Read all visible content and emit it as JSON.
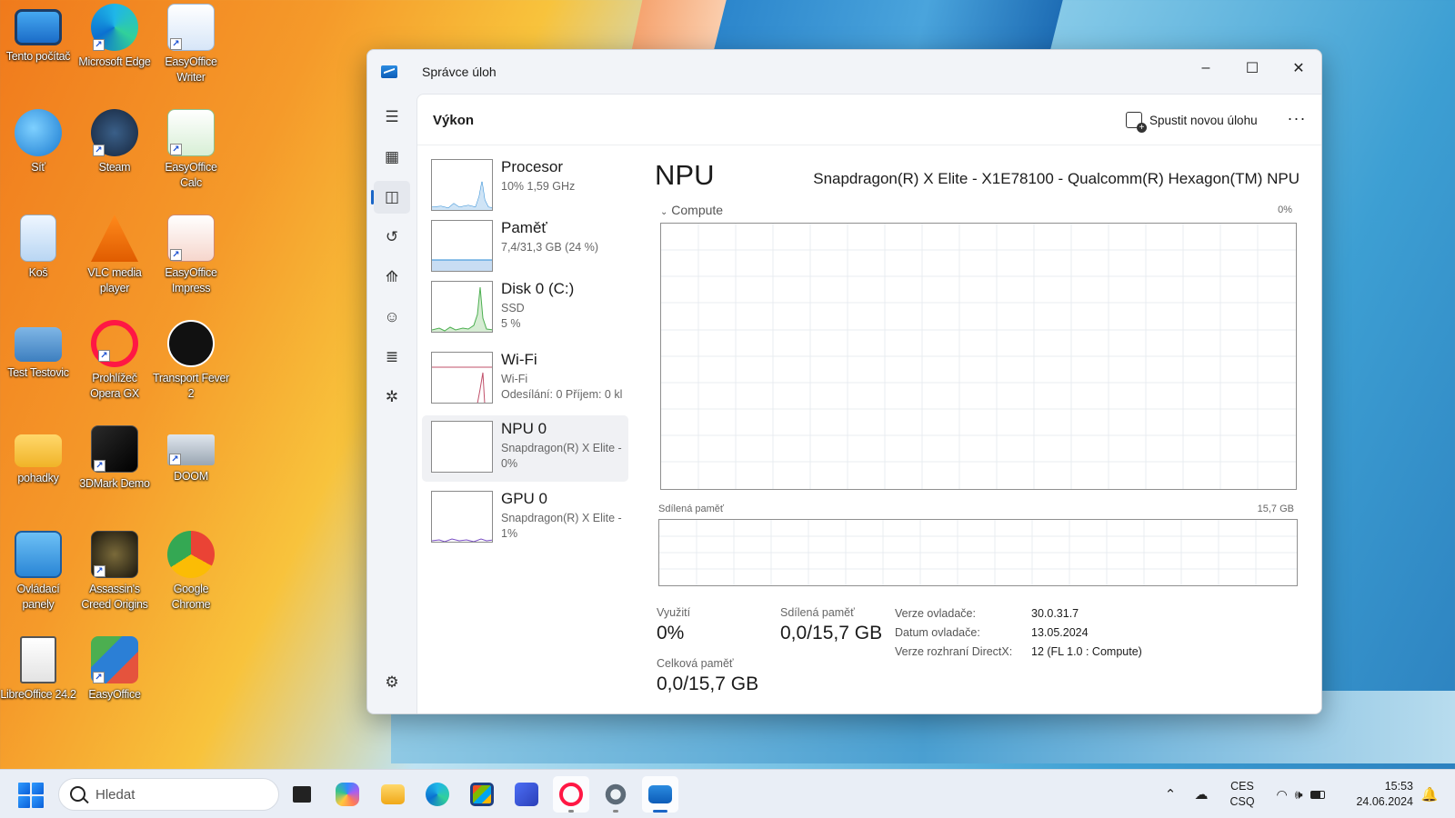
{
  "desktop": {
    "icons": [
      {
        "label": "Tento počítač"
      },
      {
        "label": "Microsoft Edge"
      },
      {
        "label": "EasyOffice Writer"
      },
      {
        "label": "Síť"
      },
      {
        "label": "Steam"
      },
      {
        "label": "EasyOffice Calc"
      },
      {
        "label": "Koš"
      },
      {
        "label": "VLC media player"
      },
      {
        "label": "EasyOffice Impress"
      },
      {
        "label": "Test Testovic"
      },
      {
        "label": "Prohlížeč Opera GX"
      },
      {
        "label": "Transport Fever 2"
      },
      {
        "label": "pohadky"
      },
      {
        "label": "3DMark Demo"
      },
      {
        "label": "DOOM"
      },
      {
        "label": "Ovládací panely"
      },
      {
        "label": "Assassin's Creed Origins"
      },
      {
        "label": "Google Chrome"
      },
      {
        "label": "LibreOffice 24.2"
      },
      {
        "label": "EasyOffice"
      }
    ]
  },
  "window": {
    "title": "Správce úloh",
    "controls": {
      "minimize": "–",
      "maximize": "☐",
      "close": "✕"
    },
    "nav": [
      "hamburger-menu",
      "processes",
      "performance",
      "app-history",
      "startup-apps",
      "users",
      "details",
      "services",
      "settings"
    ],
    "header": {
      "title": "Výkon",
      "run_task": "Spustit novou úlohu",
      "more": "···"
    },
    "devices": [
      {
        "name": "Procesor",
        "line1": "10%  1,59 GHz",
        "line2": ""
      },
      {
        "name": "Paměť",
        "line1": "7,4/31,3 GB (24 %)",
        "line2": ""
      },
      {
        "name": "Disk 0 (C:)",
        "line1": "SSD",
        "line2": "5 %"
      },
      {
        "name": "Wi-Fi",
        "line1": "Wi-Fi",
        "line2": "Odesílání: 0  Příjem: 0 kl"
      },
      {
        "name": "NPU 0",
        "line1": "Snapdragon(R) X Elite -",
        "line2": "0%"
      },
      {
        "name": "GPU 0",
        "line1": "Snapdragon(R) X Elite -",
        "line2": "1%"
      }
    ],
    "detail": {
      "title": "NPU",
      "model": "Snapdragon(R) X Elite - X1E78100 - Qualcomm(R) Hexagon(TM) NPU",
      "compute_label": "Compute",
      "compute_max": "0%",
      "shared_label": "Sdílená paměť",
      "shared_max": "15,7 GB",
      "stats": {
        "utilization_label": "Využití",
        "utilization_value": "0%",
        "shared_label": "Sdílená paměť",
        "shared_value": "0,0/15,7 GB",
        "total_label": "Celková paměť",
        "total_value": "0,0/15,7 GB"
      },
      "props": [
        {
          "label": "Verze ovladače:",
          "value": "30.0.31.7"
        },
        {
          "label": "Datum ovladače:",
          "value": "13.05.2024"
        },
        {
          "label": "Verze rozhraní DirectX:",
          "value": "12 (FL 1.0 : Compute)"
        }
      ]
    }
  },
  "taskbar": {
    "search_placeholder": "Hledat",
    "apps": [
      "task-view",
      "copilot",
      "file-explorer",
      "edge",
      "microsoft-store",
      "vs-code",
      "opera-gx",
      "settings",
      "task-manager"
    ],
    "tray": {
      "language_line1": "CES",
      "language_line2": "CSQ",
      "time": "15:53",
      "date": "24.06.2024"
    }
  },
  "colors": {
    "accent": "#1a66c7",
    "cpu_graph": "#2a8ad4",
    "disk_graph": "#4caf50",
    "wifi_graph": "#c0506a",
    "gpu_graph": "#7a4fc4"
  }
}
